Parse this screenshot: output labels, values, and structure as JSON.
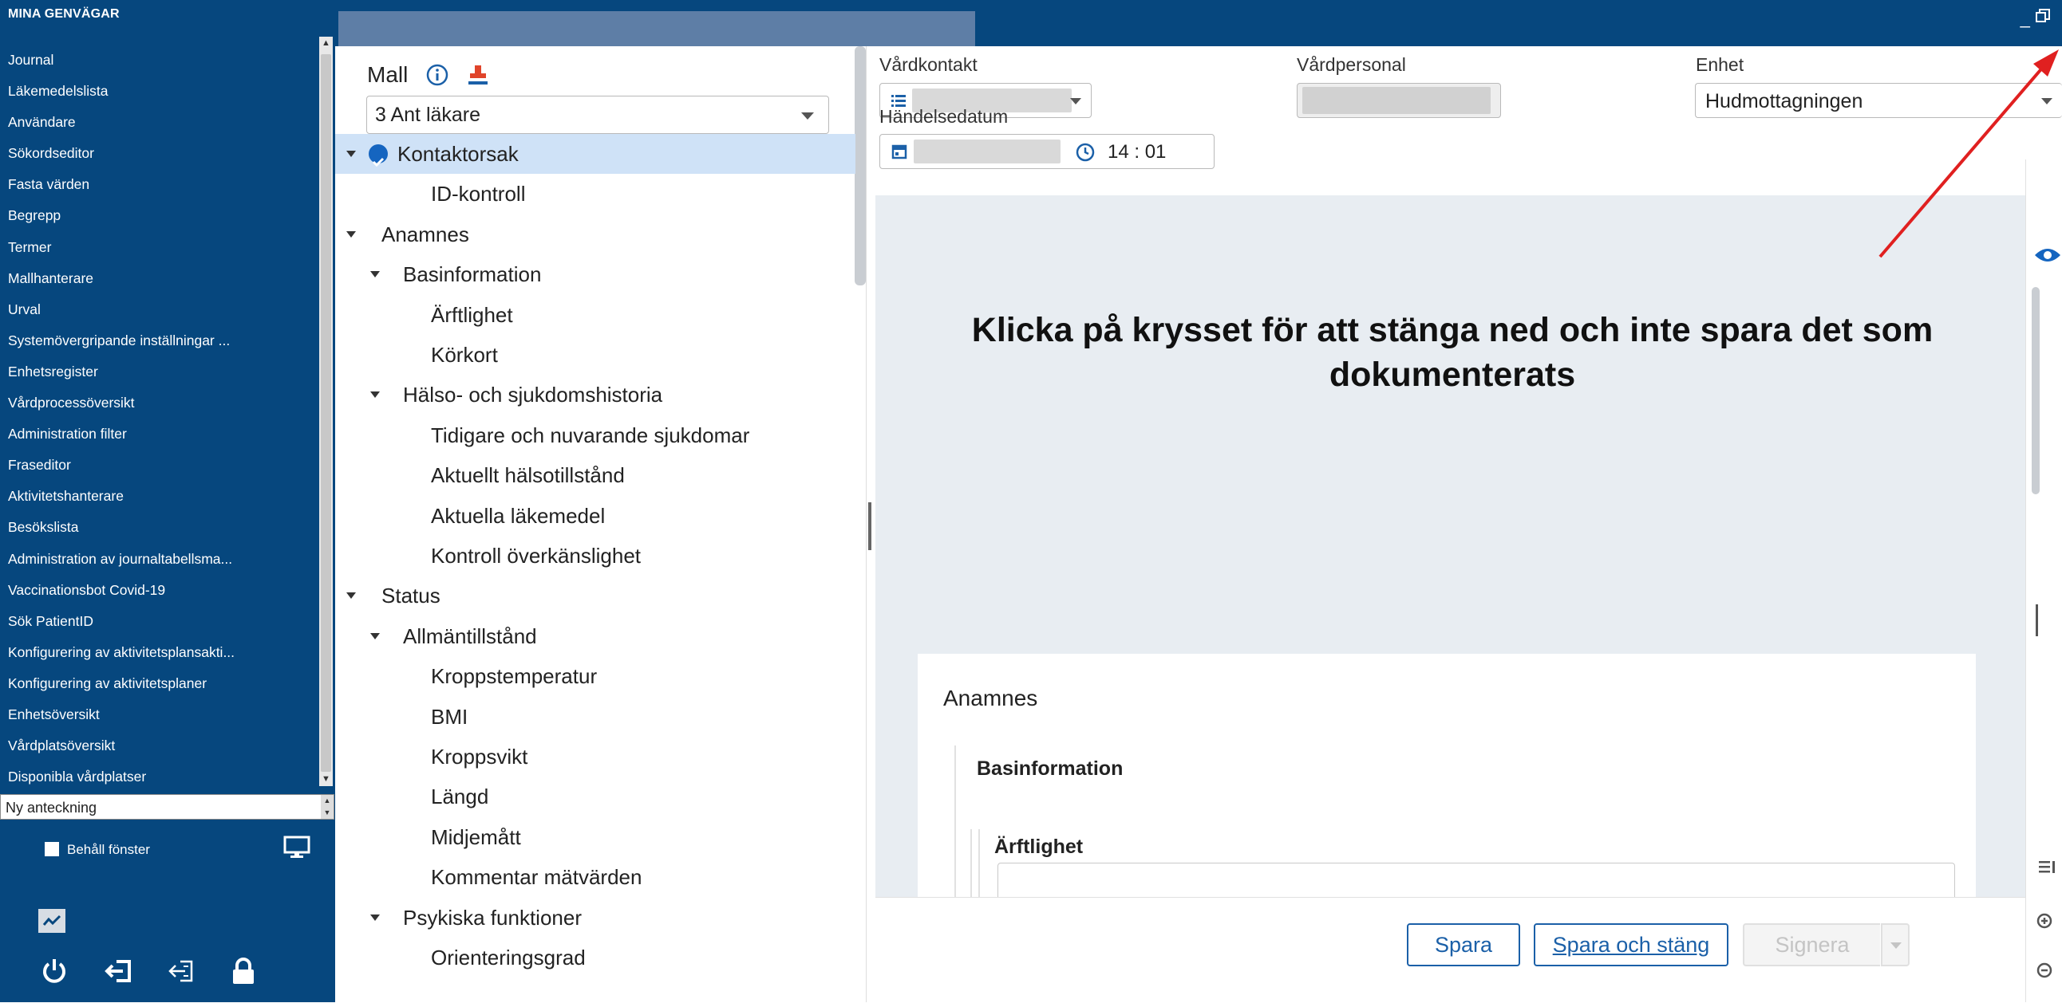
{
  "sidebar": {
    "title": "MINA GENVÄGAR",
    "items": [
      "Journal",
      "Läkemedelslista",
      "Användare",
      "Sökordseditor",
      "Fasta värden",
      "Begrepp",
      "Termer",
      "Mallhanterare",
      "Urval",
      "Systemövergripande inställningar ...",
      "Enhetsregister",
      "Vårdprocessöversikt",
      "Administration filter",
      "Fraseditor",
      "Aktivitetshanterare",
      "Besökslista",
      "Administration av journaltabellsma...",
      "Vaccinationsbot Covid-19",
      "Sök PatientID",
      "Konfigurering av aktivitetsplansakti...",
      "Konfigurering av aktivitetsplaner",
      "Enhetsöversikt",
      "Vårdplatsöversikt",
      "Disponibla vårdplatser"
    ],
    "select_value": "Ny anteckning",
    "keep_window_label": "Behåll fönster",
    "icons": [
      "monitor-icon",
      "chart-icon",
      "power-icon",
      "logout-icon",
      "switch-user-icon",
      "lock-icon"
    ]
  },
  "template": {
    "label": "Mall",
    "selected": "3 Ant läkare",
    "tree": [
      {
        "label": "Kontaktorsak",
        "level": 0,
        "toggle": true,
        "checked": true,
        "selected": true
      },
      {
        "label": "ID-kontroll",
        "level": 1
      },
      {
        "label": "Anamnes",
        "level": 0,
        "toggle": true
      },
      {
        "label": "Basinformation",
        "level": 1,
        "toggle": true
      },
      {
        "label": "Ärftlighet",
        "level": 2
      },
      {
        "label": "Körkort",
        "level": 2
      },
      {
        "label": "Hälso- och sjukdomshistoria",
        "level": 1,
        "toggle": true
      },
      {
        "label": "Tidigare och nuvarande sjukdomar",
        "level": 2
      },
      {
        "label": "Aktuellt hälsotillstånd",
        "level": 1
      },
      {
        "label": "Aktuella läkemedel",
        "level": 1
      },
      {
        "label": "Kontroll överkänslighet",
        "level": 1
      },
      {
        "label": "Status",
        "level": 0,
        "toggle": true
      },
      {
        "label": "Allmäntillstånd",
        "level": 1,
        "toggle": true
      },
      {
        "label": "Kroppstemperatur",
        "level": 2
      },
      {
        "label": "BMI",
        "level": 2
      },
      {
        "label": "Kroppsvikt",
        "level": 2
      },
      {
        "label": "Längd",
        "level": 2
      },
      {
        "label": "Midjemått",
        "level": 2
      },
      {
        "label": "Kommentar mätvärden",
        "level": 2
      },
      {
        "label": "Psykiska funktioner",
        "level": 1,
        "toggle": true
      },
      {
        "label": "Orienteringsgrad",
        "level": 2
      }
    ]
  },
  "header": {
    "vardkontakt_label": "Vårdkontakt",
    "vardpersonal_label": "Vårdpersonal",
    "enhet_label": "Enhet",
    "enhet_value": "Hudmottagningen",
    "handelsedatum_label": "Händelsedatum",
    "time_value": "14 : 01"
  },
  "annotation": {
    "text": "Klicka på krysset för att stänga ned och inte spara det som dokumenterats",
    "color": "#e02020"
  },
  "card": {
    "title": "Anamnes",
    "section": "Basinformation",
    "subsection": "Ärftlighet"
  },
  "footer": {
    "save": "Spara",
    "save_close": "Spara och stäng",
    "sign": "Signera"
  },
  "window": {
    "minimize": "_",
    "restore_icon": "restore-window-icon"
  },
  "colors": {
    "sidebar_bg": "#06477e",
    "accent": "#1b60a8",
    "selected_row": "#cfe2f7"
  }
}
